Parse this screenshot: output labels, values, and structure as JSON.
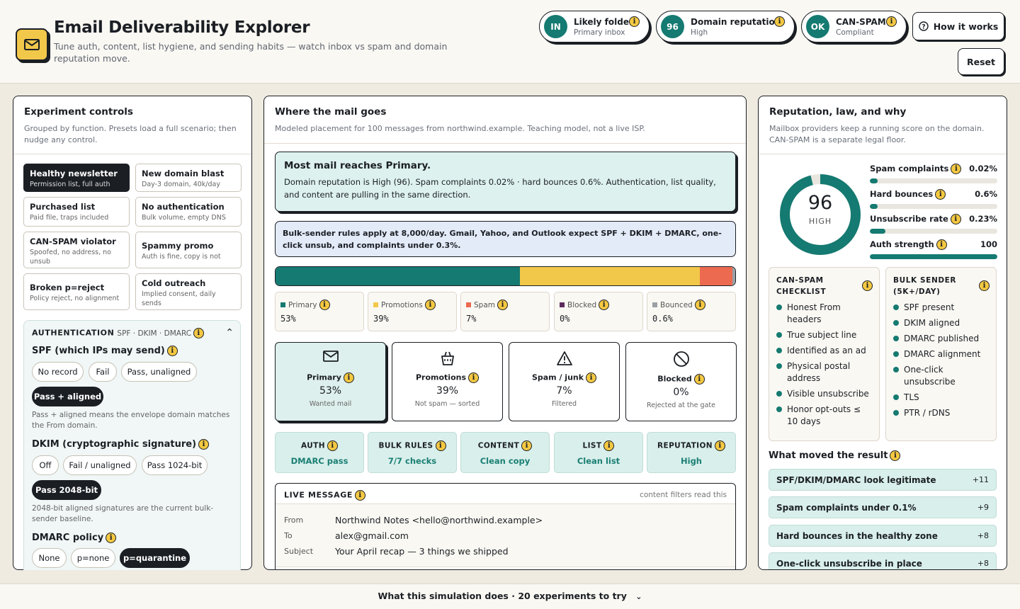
{
  "header": {
    "title": "Email Deliverability Explorer",
    "subtitle": "Tune auth, content, list hygiene, and sending habits — watch inbox vs spam and domain reputation move.",
    "pills": [
      {
        "badge": "IN",
        "title": "Likely folder",
        "sub": "Primary inbox"
      },
      {
        "badge": "96",
        "title": "Domain reputation",
        "sub": "High"
      },
      {
        "badge": "OK",
        "title": "CAN-SPAM",
        "sub": "Compliant"
      }
    ],
    "how_it_works": "How it works",
    "reset": "Reset"
  },
  "left": {
    "title": "Experiment controls",
    "subtitle": "Grouped by function. Presets load a full scenario; then nudge any control.",
    "presets": [
      {
        "name": "Healthy newsletter",
        "desc": "Permission list, full auth"
      },
      {
        "name": "New domain blast",
        "desc": "Day-3 domain, 40k/day"
      },
      {
        "name": "Purchased list",
        "desc": "Paid file, traps included"
      },
      {
        "name": "No authentication",
        "desc": "Bulk volume, empty DNS"
      },
      {
        "name": "CAN-SPAM violator",
        "desc": "Spoofed, no address, no unsub"
      },
      {
        "name": "Spammy promo",
        "desc": "Auth is fine, copy is not"
      },
      {
        "name": "Broken p=reject",
        "desc": "Policy reject, no alignment"
      },
      {
        "name": "Cold outreach",
        "desc": "Implied consent, daily sends"
      }
    ],
    "auth": {
      "heading": "AUTHENTICATION",
      "heading_sub": "SPF · DKIM · DMARC",
      "spf_label": "SPF (which IPs may send)",
      "spf_options": [
        "No record",
        "Fail",
        "Pass, unaligned",
        "Pass + aligned"
      ],
      "spf_hint": "Pass + aligned means the envelope domain matches the From domain.",
      "dkim_label": "DKIM (cryptographic signature)",
      "dkim_options": [
        "Off",
        "Fail / unaligned",
        "Pass 1024-bit",
        "Pass 2048-bit"
      ],
      "dkim_hint": "2048-bit aligned signatures are the current bulk-sender baseline.",
      "dmarc_label": "DMARC policy",
      "dmarc_options": [
        "None",
        "p=none",
        "p=quarantine"
      ]
    }
  },
  "middle": {
    "title": "Where the mail goes",
    "subtitle": "Modeled placement for 100 messages from northwind.example. Teaching model, not a live ISP.",
    "verdict_title": "Most mail reaches Primary.",
    "verdict_text": "Domain reputation is High (96). Spam complaints 0.02% · hard bounces 0.6%. Authentication, list quality, and content are pulling in the same direction.",
    "bulk_note": "Bulk-sender rules apply at 8,000/day. Gmail, Yahoo, and Outlook expect SPF + DKIM + DMARC, one-click unsub, and complaints under 0.3%.",
    "distribution": [
      {
        "name": "Primary",
        "pct": 53,
        "label": "53%",
        "color": "#157a71"
      },
      {
        "name": "Promotions",
        "pct": 39,
        "label": "39%",
        "color": "#f2c84b"
      },
      {
        "name": "Spam",
        "pct": 7,
        "label": "7%",
        "color": "#ec6a50"
      },
      {
        "name": "Blocked",
        "pct": 0,
        "label": "0%",
        "color": "#5c2d5c"
      },
      {
        "name": "Bounced",
        "pct": 0.6,
        "label": "0.6%",
        "color": "#9aa0a6"
      }
    ],
    "folders": [
      {
        "name": "Primary",
        "value": "53%",
        "sub": "Wanted mail",
        "icon": "mail-icon"
      },
      {
        "name": "Promotions",
        "value": "39%",
        "sub": "Not spam — sorted",
        "icon": "shopping-bag-icon"
      },
      {
        "name": "Spam / junk",
        "value": "7%",
        "sub": "Filtered",
        "icon": "warning-icon"
      },
      {
        "name": "Blocked",
        "value": "0%",
        "sub": "Rejected at the gate",
        "icon": "blocked-icon"
      }
    ],
    "categories": [
      {
        "name": "AUTH",
        "value": "DMARC pass"
      },
      {
        "name": "BULK RULES",
        "value": "7/7 checks"
      },
      {
        "name": "CONTENT",
        "value": "Clean copy"
      },
      {
        "name": "LIST",
        "value": "Clean list"
      },
      {
        "name": "REPUTATION",
        "value": "High"
      }
    ],
    "message": {
      "heading": "LIVE MESSAGE",
      "note": "content filters read this",
      "from_label": "From",
      "from": "Northwind Notes <hello@northwind.example>",
      "to_label": "To",
      "to": "alex@gmail.com",
      "subject_label": "Subject",
      "subject": "Your April recap — 3 things we shipped"
    }
  },
  "right": {
    "title": "Reputation, law, and why",
    "subtitle": "Mailbox providers keep a running score on the domain. CAN-SPAM is a separate legal floor.",
    "score": "96",
    "score_value": 96,
    "score_label": "HIGH",
    "metrics": [
      {
        "name": "Spam complaints",
        "value": "0.02%",
        "fill": 0.06
      },
      {
        "name": "Hard bounces",
        "value": "0.6%",
        "fill": 0.06
      },
      {
        "name": "Unsubscribe rate",
        "value": "0.23%",
        "fill": 0.12
      },
      {
        "name": "Auth strength",
        "value": "100",
        "fill": 1.0
      }
    ],
    "canspam_title": "CAN-SPAM CHECKLIST",
    "canspam_items": [
      "Honest From headers",
      "True subject line",
      "Identified as an ad",
      "Physical postal address",
      "Visible unsubscribe",
      "Honor opt-outs ≤ 10 days"
    ],
    "bulk_title": "BULK SENDER (5K+/DAY)",
    "bulk_items": [
      "SPF present",
      "DKIM aligned",
      "DMARC published",
      "DMARC alignment",
      "One-click unsubscribe",
      "TLS",
      "PTR / rDNS"
    ],
    "why_title": "What moved the result",
    "why_items": [
      {
        "label": "SPF/DKIM/DMARC look legitimate",
        "pts": "+11"
      },
      {
        "label": "Spam complaints under 0.1%",
        "pts": "+9"
      },
      {
        "label": "Hard bounces in the healthy zone",
        "pts": "+8"
      },
      {
        "label": "One-click unsubscribe in place",
        "pts": "+8"
      }
    ]
  },
  "footer": {
    "text": "What this simulation does · 20 experiments to try"
  },
  "colors": {
    "teal": "#157a71",
    "yellow": "#f2c84b",
    "ink": "#1b1f24"
  }
}
